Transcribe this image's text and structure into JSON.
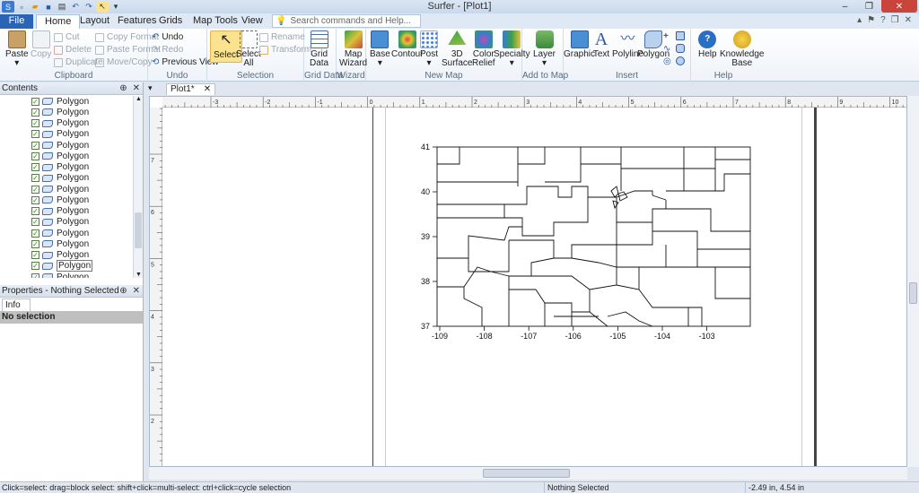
{
  "window": {
    "title": "Surfer - [Plot1]"
  },
  "tabs": [
    "File",
    "Home",
    "Layout",
    "Features",
    "Grids",
    "Map Tools",
    "View"
  ],
  "search": {
    "placeholder": "Search commands and Help..."
  },
  "ribbon": {
    "clipboard": {
      "label": "Clipboard",
      "paste": "Paste",
      "copy": "Copy",
      "cut": "Cut",
      "delete": "Delete",
      "duplicate": "Duplicate",
      "copy_format": "Copy Format",
      "paste_format": "Paste Format",
      "move_copy": "Move/Copy"
    },
    "undo": {
      "label": "Undo",
      "undo": "Undo",
      "redo": "Redo",
      "previous_view": "Previous View"
    },
    "selection": {
      "label": "Selection",
      "select": "Select",
      "select_all_1": "Select",
      "select_all_2": "All",
      "rename": "Rename",
      "transform": "Transform"
    },
    "grid_data": {
      "label": "Grid Data",
      "btn_1": "Grid",
      "btn_2": "Data"
    },
    "wizard": {
      "label": "Wizard",
      "btn_1": "Map",
      "btn_2": "Wizard"
    },
    "new_map": {
      "label": "New Map",
      "base": "Base",
      "contour": "Contour",
      "post": "Post",
      "surface_1": "3D",
      "surface_2": "Surface",
      "color_1": "Color",
      "color_2": "Relief",
      "specialty": "Specialty"
    },
    "add_to_map": {
      "label": "Add to Map",
      "layer": "Layer"
    },
    "insert": {
      "label": "Insert",
      "graphic": "Graphic",
      "text": "Text",
      "polyline": "Polyline",
      "polygon": "Polygon"
    },
    "help": {
      "label": "Help",
      "help": "Help",
      "kb_1": "Knowledge",
      "kb_2": "Base"
    }
  },
  "contents": {
    "title": "Contents",
    "items": [
      "Polygon",
      "Polygon",
      "Polygon",
      "Polygon",
      "Polygon",
      "Polygon",
      "Polygon",
      "Polygon",
      "Polygon",
      "Polygon",
      "Polygon",
      "Polygon",
      "Polygon",
      "Polygon",
      "Polygon",
      "Polygon",
      "Polygon"
    ],
    "selected_index": 15
  },
  "properties": {
    "title": "Properties - Nothing Selected",
    "tab": "Info",
    "selection": "No selection"
  },
  "document": {
    "tab": "Plot1*"
  },
  "ruler": {
    "top_labels": [
      "-3",
      "-2",
      "-1",
      "0",
      "1",
      "2",
      "3",
      "4",
      "5",
      "6",
      "7",
      "8",
      "9",
      "10"
    ],
    "left_labels": [
      "7",
      "6",
      "5",
      "4",
      "3",
      "2"
    ]
  },
  "map": {
    "y_ticks": [
      "41",
      "40",
      "39",
      "38",
      "37"
    ],
    "x_ticks": [
      "-109",
      "-108",
      "-107",
      "-106",
      "-105",
      "-104",
      "-103"
    ]
  },
  "status": {
    "hint": "Click=select: drag=block select: shift+click=multi-select: ctrl+click=cycle selection",
    "selection": "Nothing Selected",
    "coords": "-2.49 in, 4.54 in"
  }
}
